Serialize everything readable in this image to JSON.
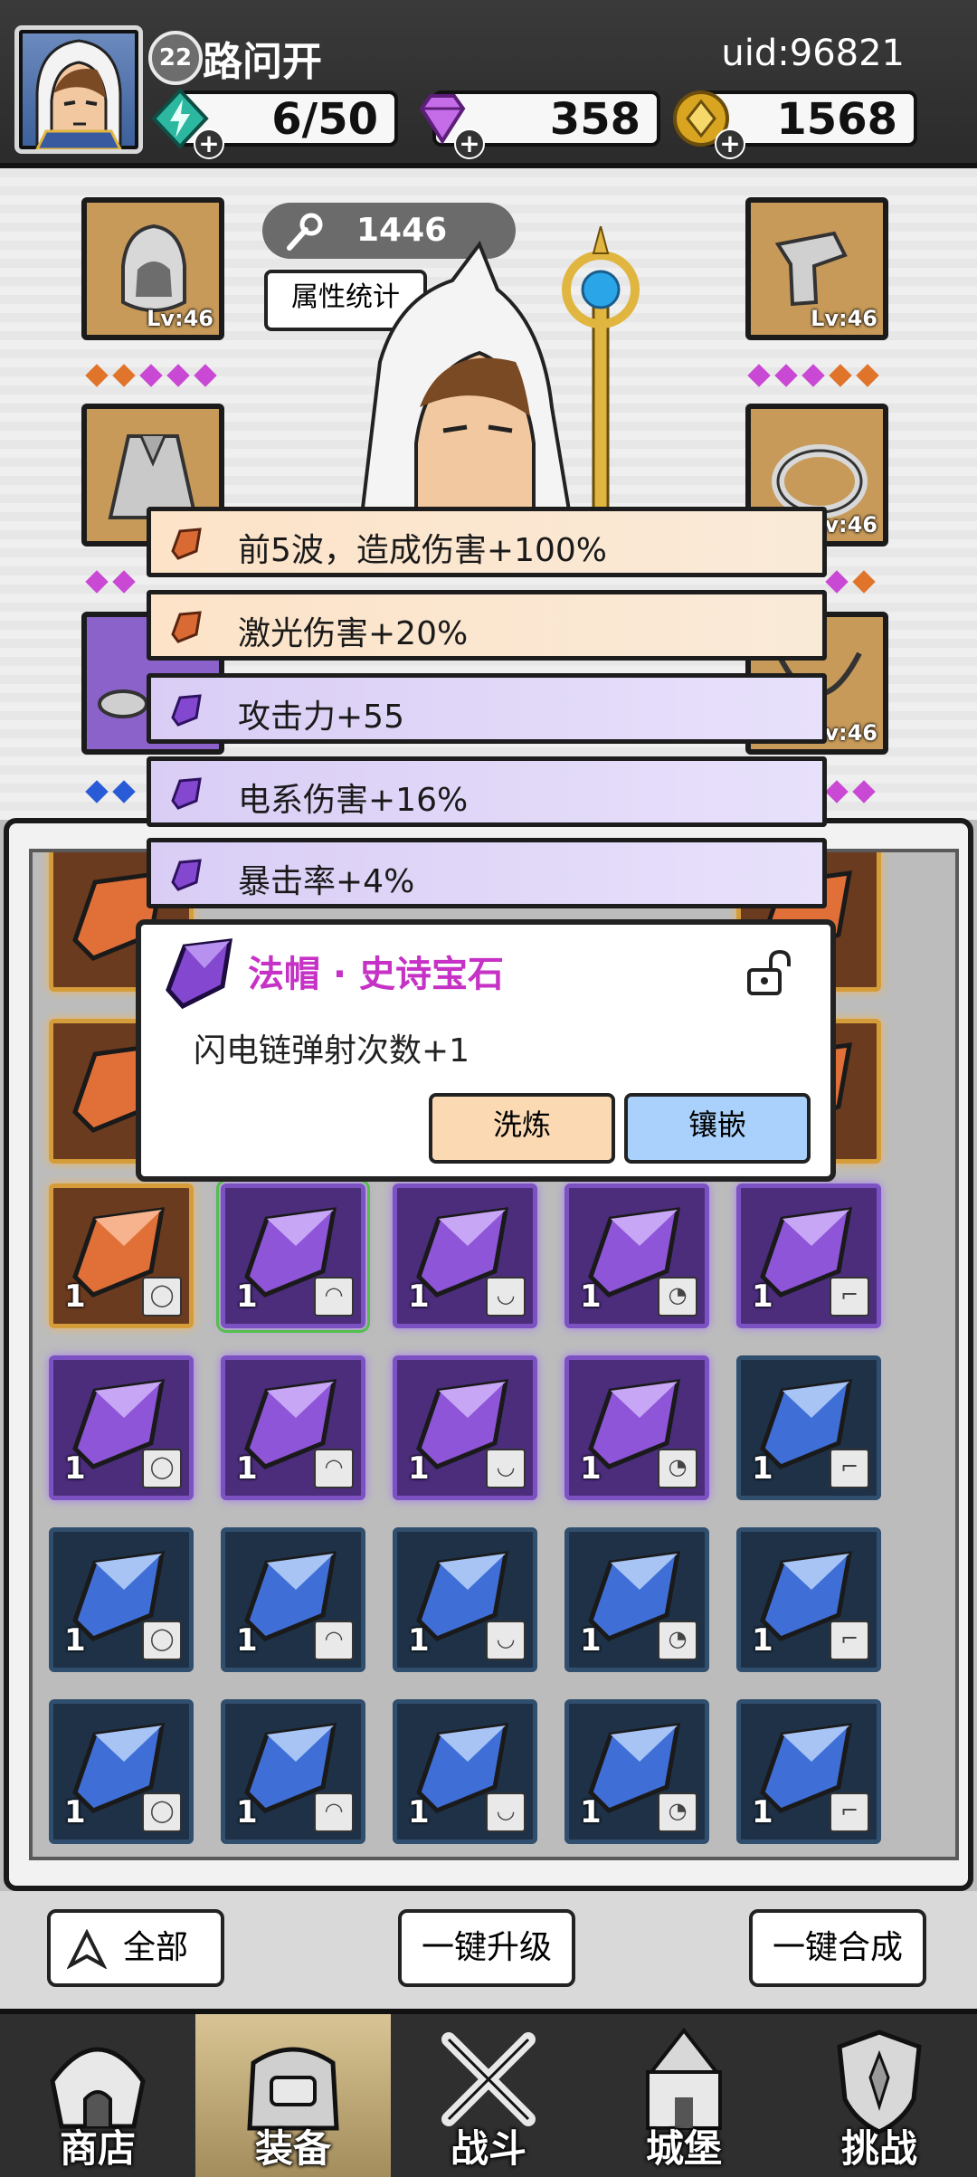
{
  "player": {
    "level": "22",
    "name": "路问开",
    "uid": "uid:96821"
  },
  "resources": {
    "energy": {
      "value": "6/50",
      "icon": "lightning-gem-icon",
      "color": "#2bb7a0"
    },
    "diamonds": {
      "value": "358",
      "icon": "purple-diamond-icon",
      "color": "#c56de8"
    },
    "gold": {
      "value": "1568",
      "icon": "gold-coin-icon",
      "color": "#d9a520"
    }
  },
  "equipment": {
    "power": "1446",
    "stats_label": "属性统计",
    "slots": [
      {
        "name": "hood",
        "level": "Lv:46"
      },
      {
        "name": "gauntlet",
        "level": "Lv:46"
      },
      {
        "name": "cloak",
        "level": ""
      },
      {
        "name": "ring",
        "level": "Lv:46"
      },
      {
        "name": "boots",
        "level": ""
      },
      {
        "name": "necklace",
        "level": "Lv:46"
      }
    ]
  },
  "gem_stats": [
    {
      "text": "前5波，造成伤害+100%",
      "rarity": "orange"
    },
    {
      "text": "激光伤害+20%",
      "rarity": "orange"
    },
    {
      "text": "攻击力+55",
      "rarity": "purple"
    },
    {
      "text": "电系伤害+16%",
      "rarity": "purple"
    },
    {
      "text": "暴击率+4%",
      "rarity": "purple"
    }
  ],
  "gem_detail": {
    "title": "法帽 · 史诗宝石",
    "description": "闪电链弹射次数+1",
    "refine_label": "洗炼",
    "inlay_label": "镶嵌"
  },
  "inventory": [
    [
      "orange",
      "1"
    ],
    [
      "purple",
      "1"
    ],
    [
      "purple",
      "1"
    ],
    [
      "purple",
      "1"
    ],
    [
      "purple",
      "1"
    ],
    [
      "purple",
      "1"
    ],
    [
      "purple",
      "1"
    ],
    [
      "purple",
      "1"
    ],
    [
      "purple",
      "1"
    ],
    [
      "blue",
      "1"
    ],
    [
      "blue",
      "1"
    ],
    [
      "blue",
      "1"
    ],
    [
      "blue",
      "1"
    ],
    [
      "blue",
      "1"
    ],
    [
      "blue",
      "1"
    ],
    [
      "blue",
      "1"
    ],
    [
      "blue",
      "1"
    ],
    [
      "blue",
      "1"
    ],
    [
      "blue",
      "1"
    ],
    [
      "blue",
      "1"
    ]
  ],
  "actions": {
    "filter_label": "全部",
    "upgrade_all": "一键升级",
    "merge_all": "一键合成"
  },
  "nav": [
    {
      "label": "商店",
      "icon": "shop-icon"
    },
    {
      "label": "装备",
      "icon": "backpack-icon"
    },
    {
      "label": "战斗",
      "icon": "crossed-swords-icon"
    },
    {
      "label": "城堡",
      "icon": "castle-icon"
    },
    {
      "label": "挑战",
      "icon": "shield-icon"
    }
  ]
}
